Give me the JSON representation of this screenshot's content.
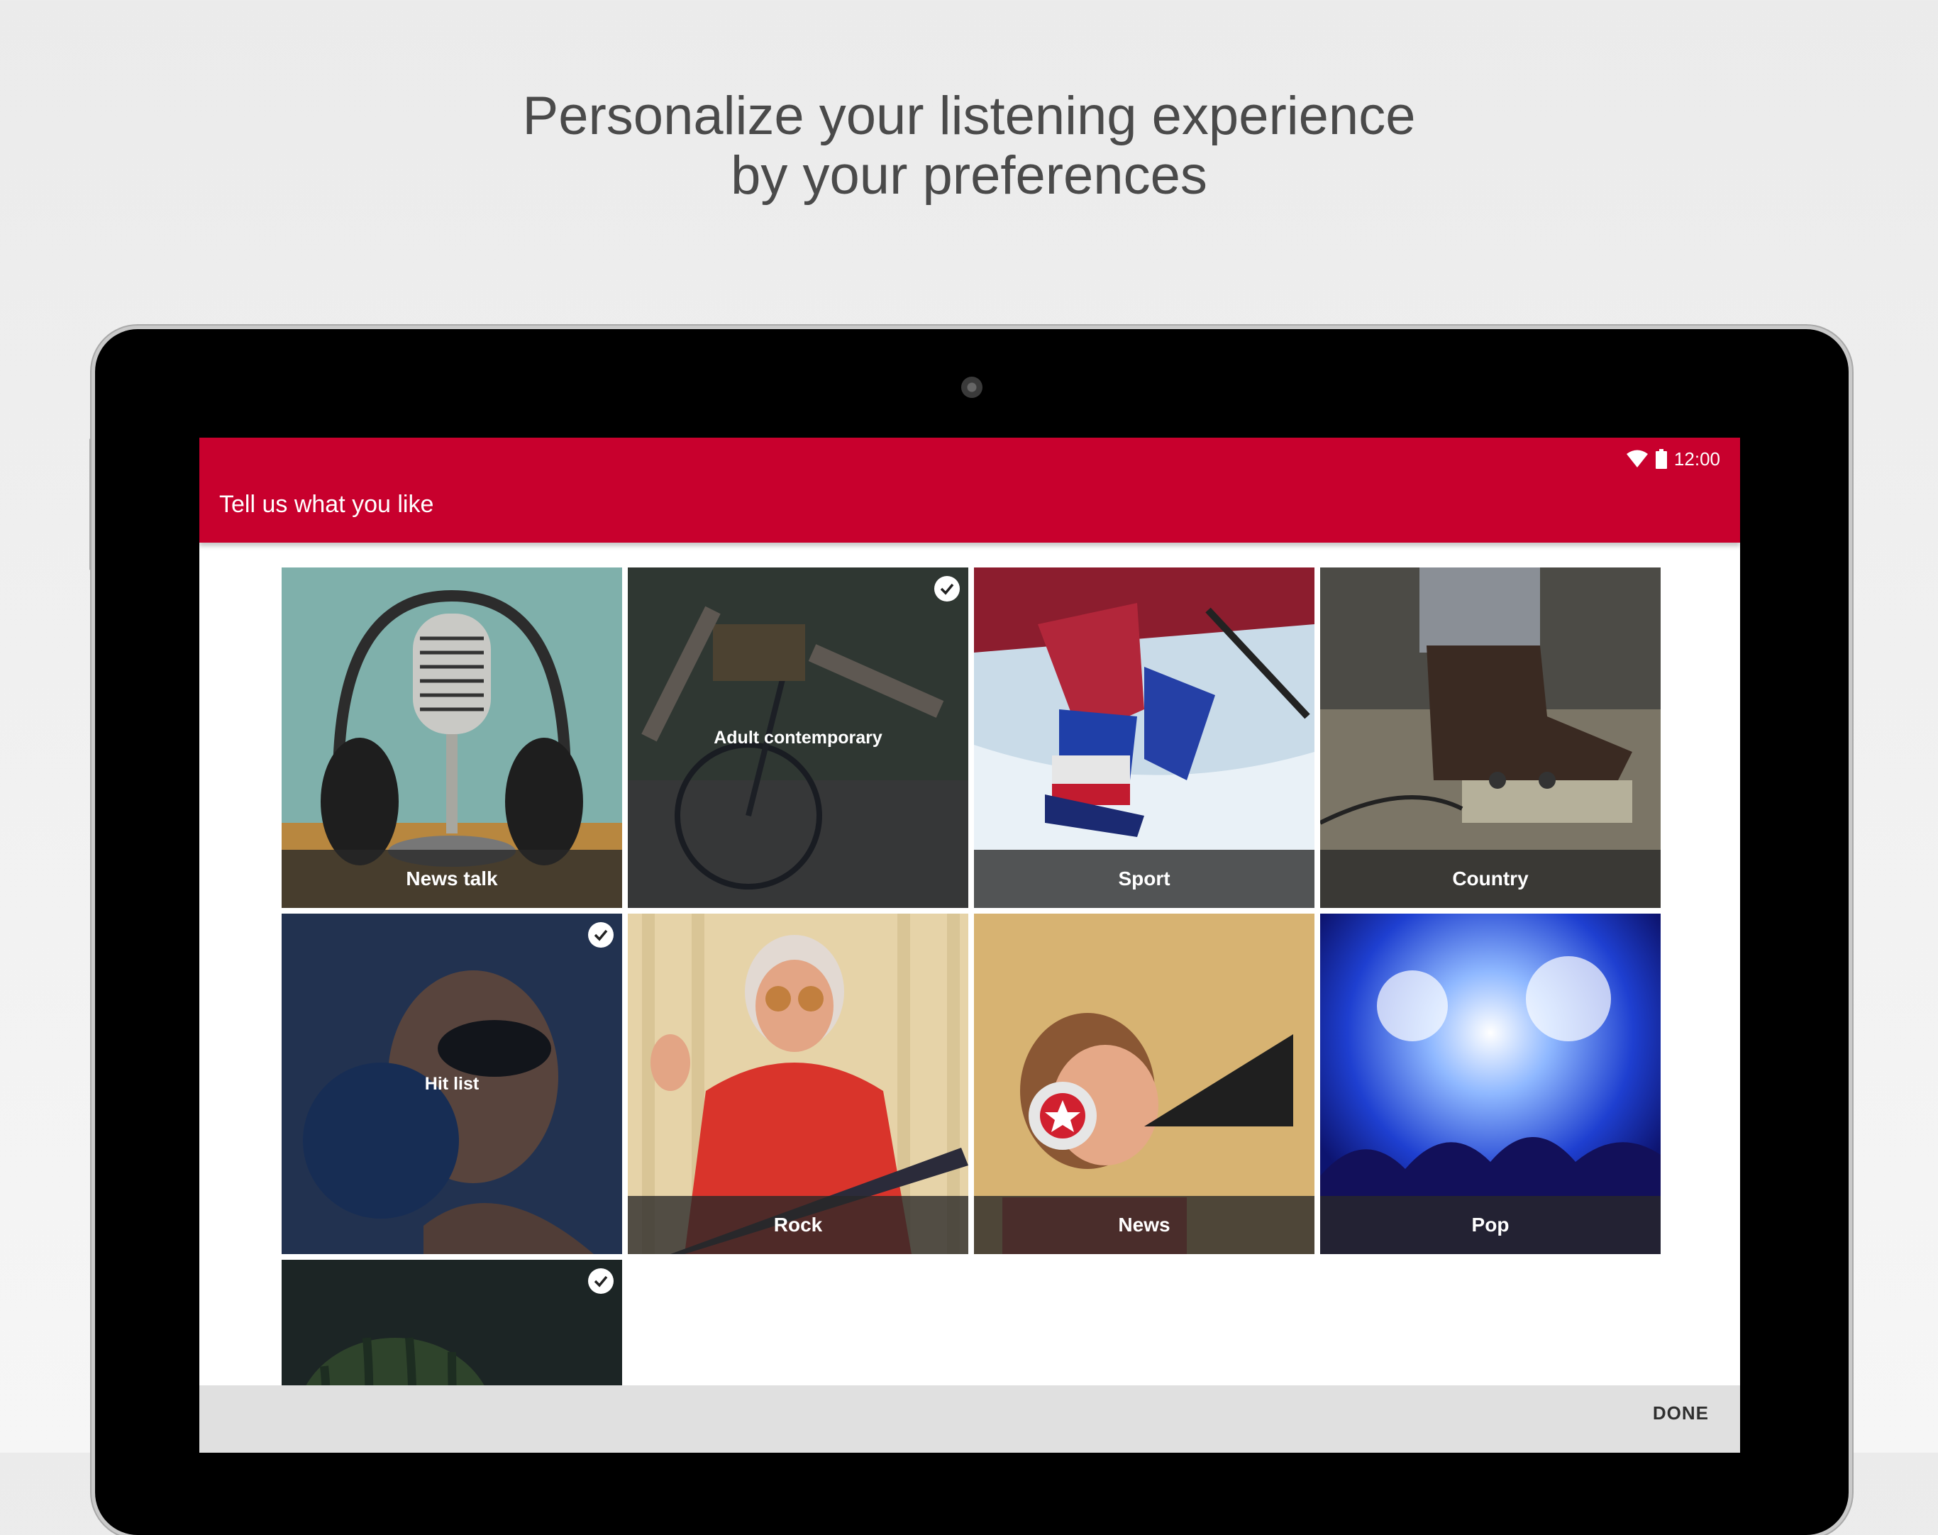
{
  "headline": {
    "line1": "Personalize your listening experience",
    "line2": "by your preferences"
  },
  "status_bar": {
    "time": "12:00",
    "icons": [
      "wifi-icon",
      "battery-icon"
    ]
  },
  "app_bar": {
    "title": "Tell us what you like",
    "color": "#c8002d"
  },
  "tiles": [
    {
      "label": "News talk",
      "selected": false
    },
    {
      "label": "Adult contemporary",
      "selected": true
    },
    {
      "label": "Sport",
      "selected": false
    },
    {
      "label": "Country",
      "selected": false
    },
    {
      "label": "Hit list",
      "selected": true
    },
    {
      "label": "Rock",
      "selected": false
    },
    {
      "label": "News",
      "selected": false
    },
    {
      "label": "Pop",
      "selected": false
    },
    {
      "label": "",
      "selected": true
    }
  ],
  "bottom_bar": {
    "done_label": "DONE"
  }
}
